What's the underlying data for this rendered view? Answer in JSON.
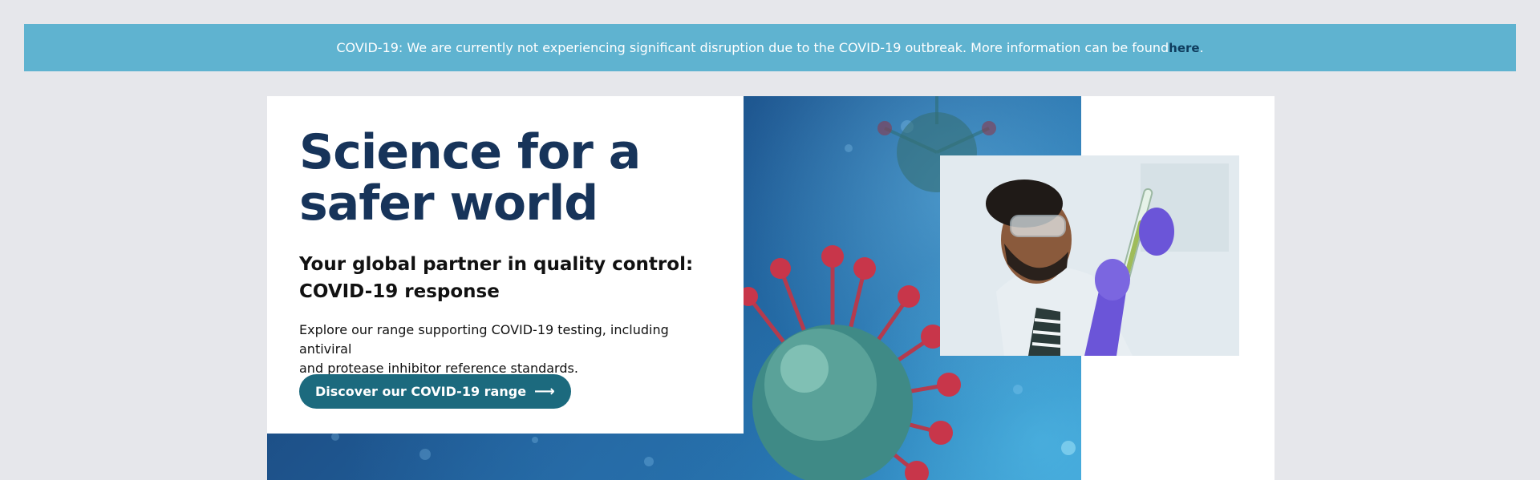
{
  "banner": {
    "text": "COVID-19: We are currently not experiencing significant disruption due to the COVID-19 outbreak. More information can be found ",
    "link_label": "here",
    "suffix": "."
  },
  "hero": {
    "headline_line1": "Science for a",
    "headline_line2": "safer world",
    "subhead_line1": "Your global partner in quality control:",
    "subhead_line2": "COVID-19 response",
    "body_line1": "Explore our range supporting COVID-19 testing, including antiviral",
    "body_line2": "and protease inhibitor reference standards.",
    "cta_label": "Discover our COVID-19 range",
    "cta_icon": "arrow-right-icon"
  },
  "images": {
    "background": "coronavirus-illustration",
    "photo": "scientist-with-test-tube-photo"
  },
  "colors": {
    "banner": "#5fb3d0",
    "headline": "#17345a",
    "cta": "#1c6a7e",
    "page_bg": "#e6e7eb"
  }
}
